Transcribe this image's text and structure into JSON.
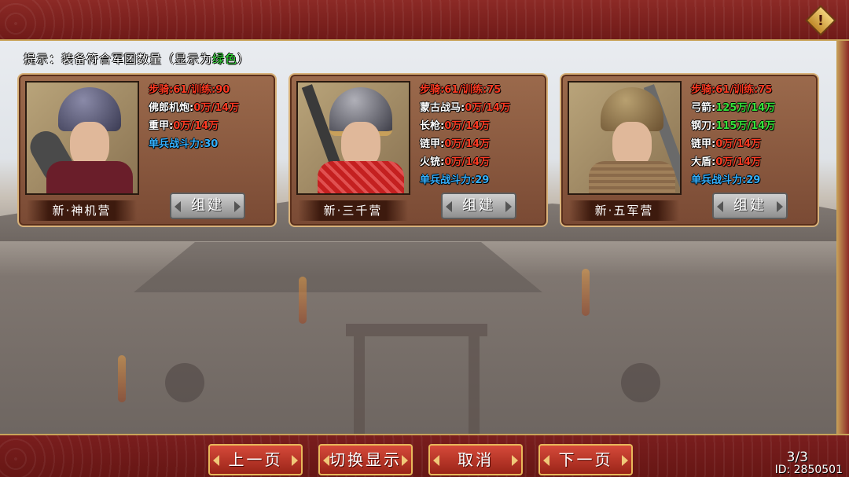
{
  "hint": {
    "prefix": "提示：装备符合军团数量（显示为",
    "green_word": "绿色",
    "suffix": "）"
  },
  "cards": [
    {
      "name": "新·神机营",
      "build_label": "组建",
      "lines": [
        {
          "text": "步骑:61/训练:90",
          "color": "red"
        },
        {
          "text": "佛郎机炮:0万/14万",
          "color": "white",
          "label": "佛郎机炮:",
          "value": "0万/14万",
          "value_color": "red"
        },
        {
          "text": "重甲:0万/14万",
          "color": "white",
          "label": "重甲:",
          "value": "0万/14万",
          "value_color": "red"
        },
        {
          "text": "单兵战斗力:30",
          "color": "blue"
        }
      ]
    },
    {
      "name": "新·三千营",
      "build_label": "组建",
      "lines": [
        {
          "text": "步骑:61/训练:75",
          "color": "red"
        },
        {
          "text": "蒙古战马:0万/14万",
          "label": "蒙古战马:",
          "value": "0万/14万",
          "value_color": "red"
        },
        {
          "text": "长枪:0万/14万",
          "label": "长枪:",
          "value": "0万/14万",
          "value_color": "red"
        },
        {
          "text": "链甲:0万/14万",
          "label": "链甲:",
          "value": "0万/14万",
          "value_color": "red"
        },
        {
          "text": "火铳:0万/14万",
          "label": "火铳:",
          "value": "0万/14万",
          "value_color": "red"
        },
        {
          "text": "单兵战斗力:29",
          "color": "blue"
        }
      ]
    },
    {
      "name": "新·五军营",
      "build_label": "组建",
      "lines": [
        {
          "text": "步骑:61/训练:75",
          "color": "red"
        },
        {
          "text": "弓箭:125万/14万",
          "label": "弓箭:",
          "value": "125万/14万",
          "value_color": "green"
        },
        {
          "text": "钢刀:115万/14万",
          "label": "钢刀:",
          "value": "115万/14万",
          "value_color": "green"
        },
        {
          "text": "链甲:0万/14万",
          "label": "链甲:",
          "value": "0万/14万",
          "value_color": "red"
        },
        {
          "text": "大盾:0万/14万",
          "label": "大盾:",
          "value": "0万/14万",
          "value_color": "red"
        },
        {
          "text": "单兵战斗力:29",
          "color": "blue"
        }
      ]
    }
  ],
  "buttons": {
    "prev": "上一页",
    "toggle": "切换显示",
    "cancel": "取消",
    "next": "下一页"
  },
  "page_indicator": "3/3",
  "uid": "ID: 2850501",
  "warning_icon": "!",
  "colors": {
    "red": "#ff3a22",
    "green": "#34e23a",
    "blue": "#33b0ff",
    "white": "#ffffff",
    "button_red": "#c03a2a",
    "frame_gold": "#d8b27a"
  }
}
